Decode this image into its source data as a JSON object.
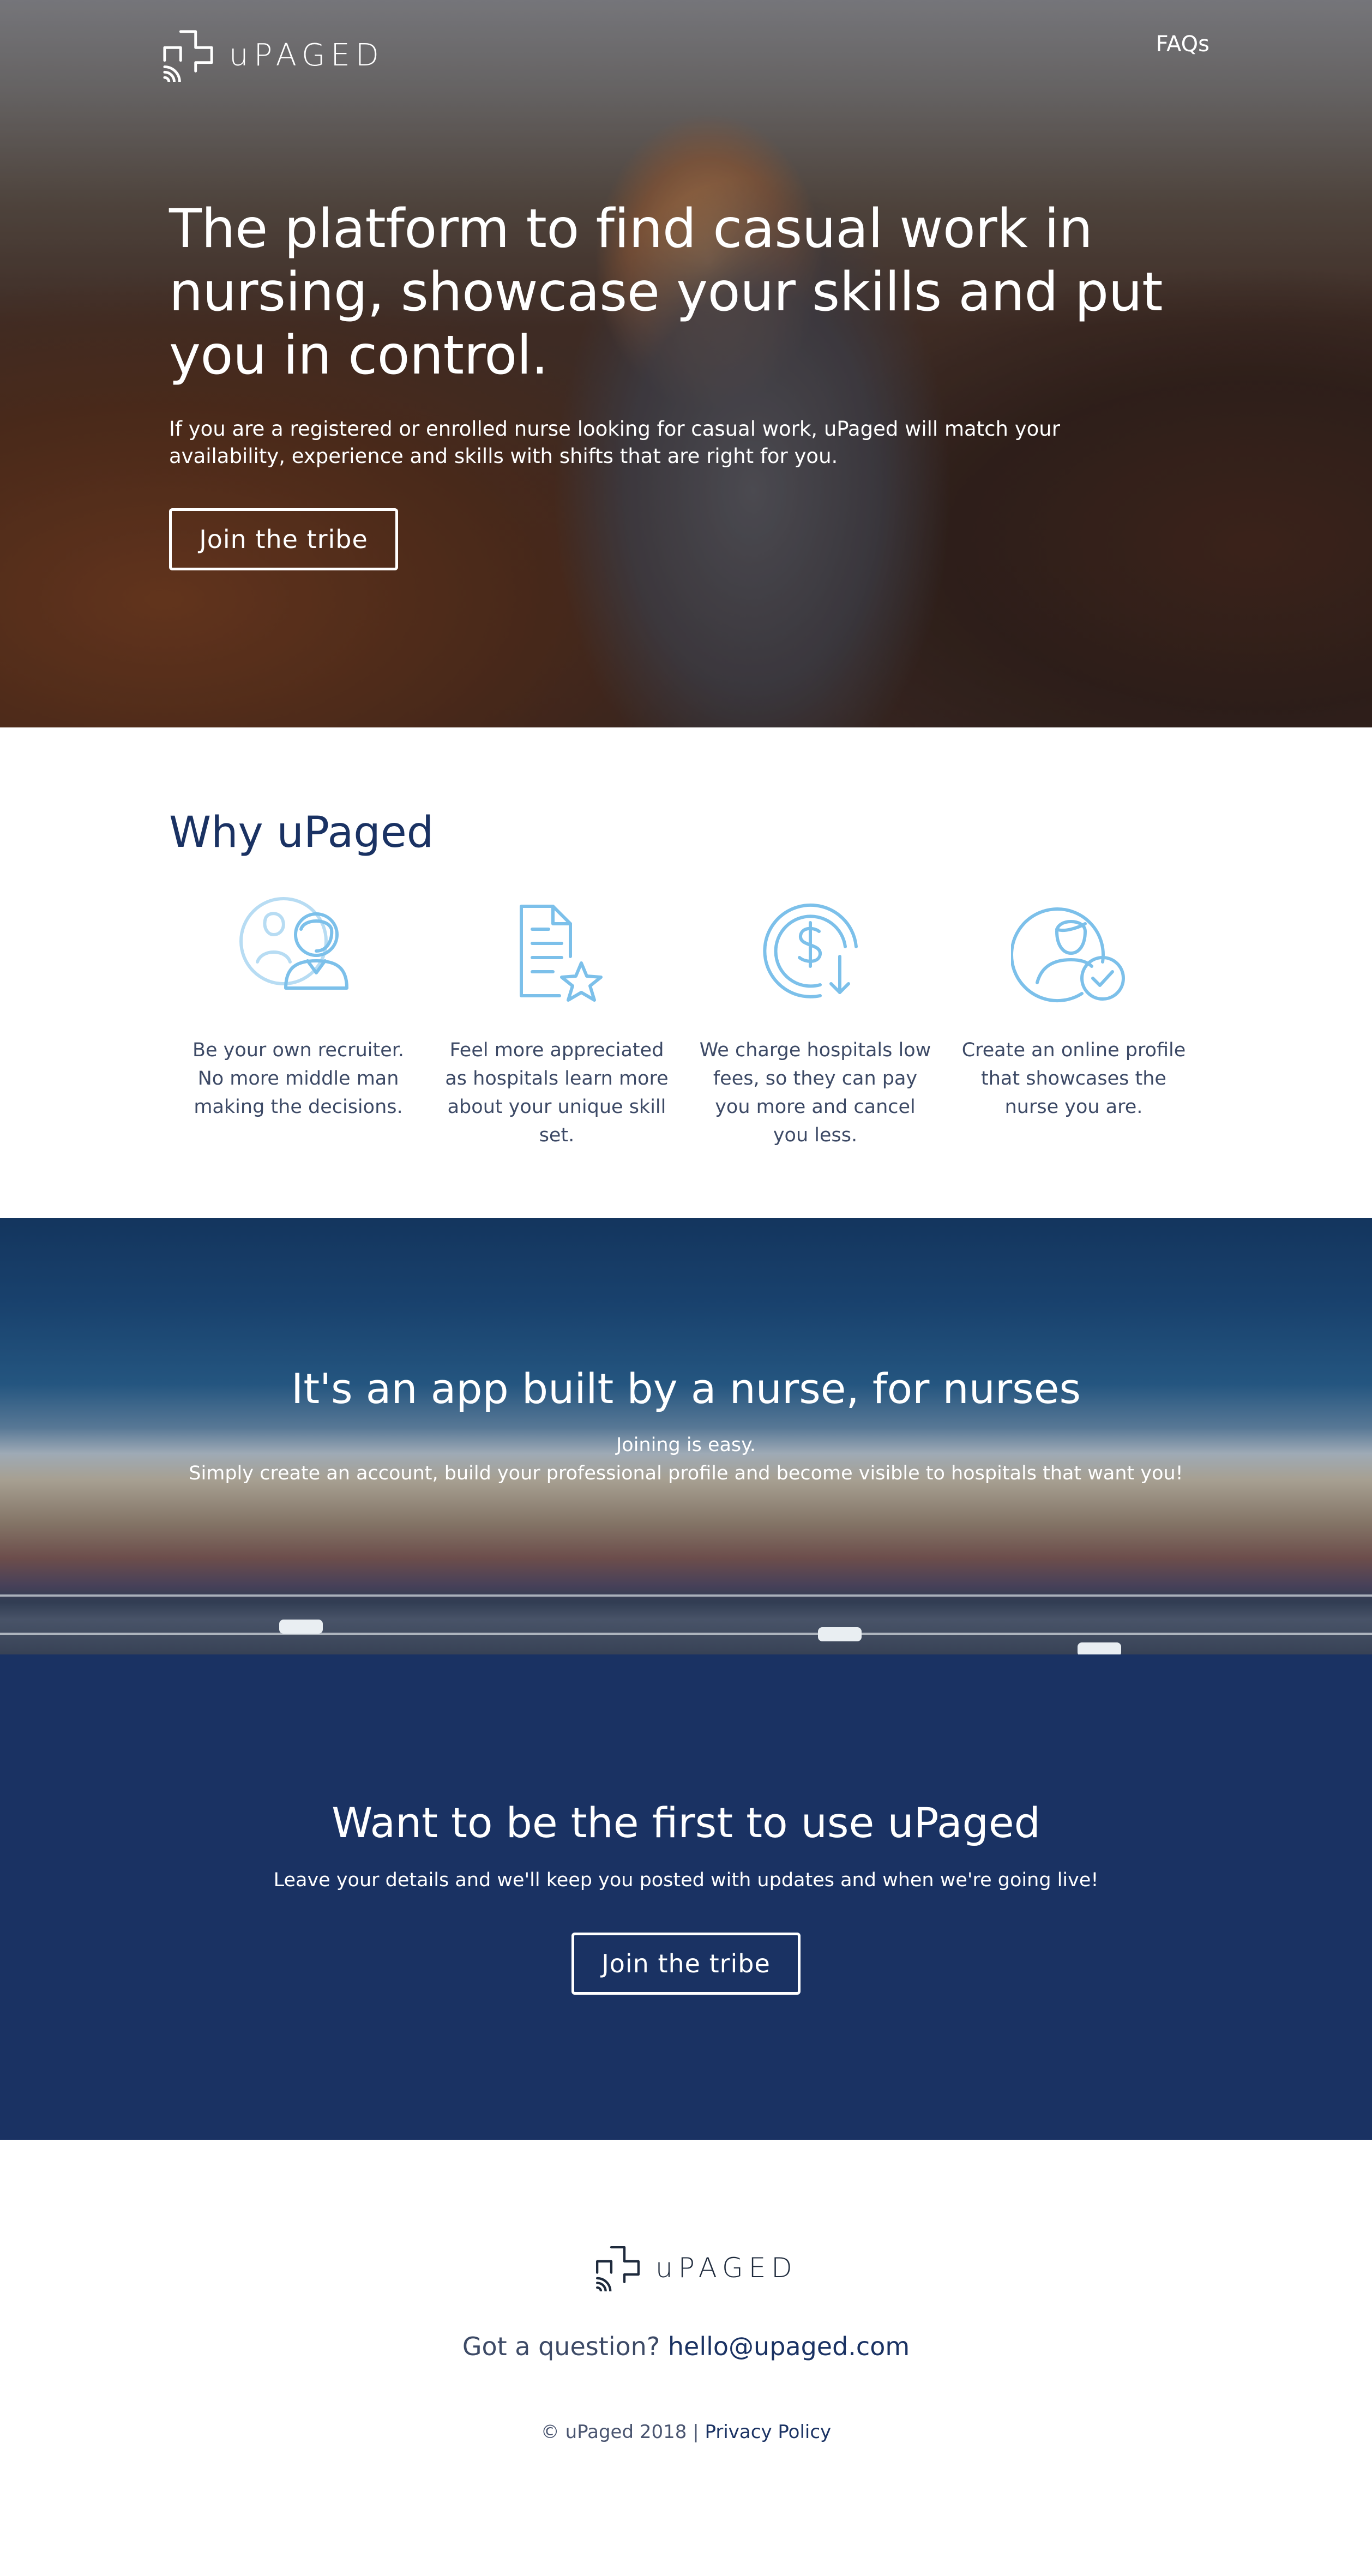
{
  "brand": {
    "name": "uPAGED"
  },
  "nav": {
    "faq_label": "FAQs"
  },
  "hero": {
    "title": "The platform to find casual work in nursing, showcase your skills and put you in control.",
    "subtitle": "If you are a registered or enrolled nurse looking for casual work, uPaged will match your availability, experience and skills with shifts that are right for you.",
    "cta_label": "Join the tribe"
  },
  "why": {
    "title": "Why uPaged",
    "features": [
      {
        "icon": "recruiter-icon",
        "text": "Be your own recruiter. No more middle man making the decisions."
      },
      {
        "icon": "document-star-icon",
        "text": "Feel more appreciated as hospitals learn more about your unique skill set."
      },
      {
        "icon": "dollar-refund-icon",
        "text": "We charge hospitals low fees, so they can pay you more and cancel you less."
      },
      {
        "icon": "profile-check-icon",
        "text": "Create an online profile that showcases the nurse you are."
      }
    ],
    "icon_color": "#7cc0ea"
  },
  "app": {
    "title": "It's an app built by a nurse, for nurses",
    "line1": "Joining is easy.",
    "line2": "Simply create an account, build your professional profile and become visible to hospitals that want you!"
  },
  "signup": {
    "title": "Want to be the first to use uPaged",
    "subtitle": "Leave your details and we'll keep you posted with updates and when we're going live!",
    "cta_label": "Join the tribe"
  },
  "footer": {
    "question_prefix": "Got a question?",
    "email": "hello@upaged.com",
    "copyright": "© uPaged 2018 |",
    "privacy_label": "Privacy Policy"
  },
  "colors": {
    "navy": "#1a3263",
    "accent": "#7cc0ea",
    "white": "#ffffff"
  }
}
